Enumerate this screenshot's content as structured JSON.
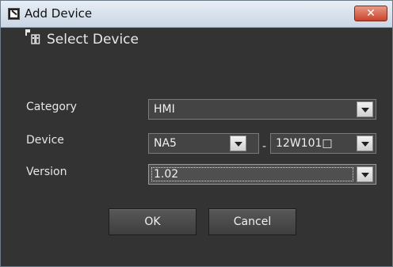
{
  "window": {
    "title": "Add Device",
    "app_icon": "device-app-icon",
    "close_label": "✕"
  },
  "header": {
    "icon": "device-icon",
    "title": "Select Device"
  },
  "form": {
    "category": {
      "label": "Category",
      "value": "HMI"
    },
    "device": {
      "label": "Device",
      "value": "NA5",
      "separator": "-",
      "model_value": "12W101□"
    },
    "version": {
      "label": "Version",
      "value": "1.02"
    }
  },
  "buttons": {
    "ok": "OK",
    "cancel": "Cancel"
  }
}
